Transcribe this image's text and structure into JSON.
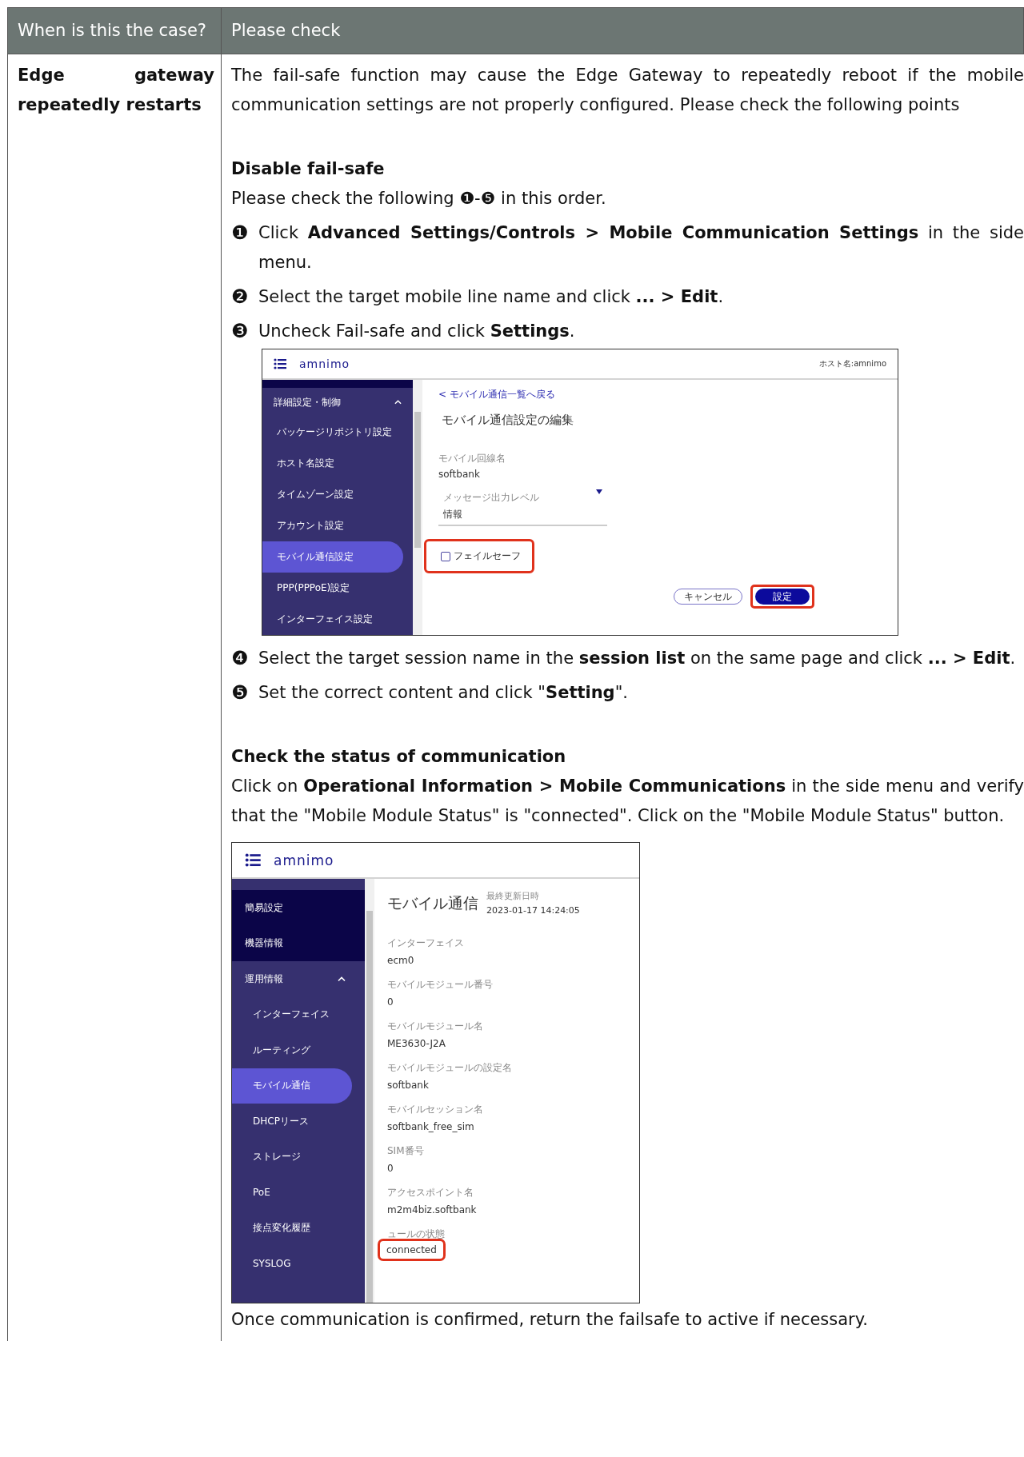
{
  "header": {
    "case_heading": "When is this the case?",
    "check_heading": "Please check"
  },
  "case": "Edge gateway repeatedly restarts",
  "blocks": [
    {
      "kind": "paragraph",
      "text": "The fail-safe function may cause the Edge Gateway to repeatedly reboot if the mobile communication settings are not properly configured. Please check the following points"
    },
    {
      "kind": "heading",
      "text": "Disable fail-safe"
    },
    {
      "kind": "paragraph",
      "text": "Please check the following ❶-❺ in this order."
    },
    {
      "kind": "step",
      "marker": "❶",
      "text": "Click **Advanced Settings/Controls > Mobile Communication Settings** in the side menu."
    },
    {
      "kind": "step",
      "marker": "❷",
      "text": "Select the target mobile line name and click **... > Edit**."
    },
    {
      "kind": "step",
      "marker": "❸",
      "text": "Uncheck Fail-safe and click **Settings**."
    },
    {
      "kind": "settings_screenshot",
      "logo": "amnimo",
      "host": "ホスト名:amnimo",
      "sidebar": {
        "items": [
          {
            "label": "詳細設定・制御",
            "expanded": true,
            "children": [
              {
                "label": "パッケージリポジトリ設定",
                "selected": false
              },
              {
                "label": "ホスト名設定",
                "selected": false
              },
              {
                "label": "タイムゾーン設定",
                "selected": false
              },
              {
                "label": "アカウント設定",
                "selected": false
              },
              {
                "label": "モバイル通信設定",
                "selected": true
              },
              {
                "label": "PPP(PPPoE)設定",
                "selected": false
              },
              {
                "label": "インターフェイス設定",
                "selected": false
              }
            ]
          }
        ]
      },
      "back_link": "< モバイル通信一覧へ戻る",
      "title": "モバイル通信設定の編集",
      "line_name": {
        "label": "モバイル回線名",
        "value": "softbank"
      },
      "message_level": {
        "label": "メッセージ出力レベル",
        "value": "情報"
      },
      "checkbox": {
        "label": "フェイルセーフ",
        "checked": false,
        "highlighted": true
      },
      "buttons": [
        {
          "label": "キャンセル",
          "kind": "outline",
          "highlighted": false
        },
        {
          "label": "設定",
          "kind": "primary",
          "highlighted": true
        }
      ]
    },
    {
      "kind": "step",
      "marker": "❹",
      "text": "Select the target session name in the **session list** on the same page and click **... > Edit**."
    },
    {
      "kind": "step",
      "marker": "❺",
      "text": "Set the correct content and click \"**Setting**\"."
    },
    {
      "kind": "heading",
      "text": "Check the status of communication"
    },
    {
      "kind": "paragraph",
      "text": "Click on **Operational Information > Mobile Communications** in the side menu and verify that the \"Mobile Module Status\" is \"connected\". Click on the \"Mobile Module Status\" button."
    },
    {
      "kind": "status_screenshot",
      "logo": "amnimo",
      "sidebar": {
        "items": [
          {
            "label": "簡易設定",
            "selected": false
          },
          {
            "label": "機器情報",
            "selected": false
          },
          {
            "label": "運用情報",
            "expanded": true,
            "children": [
              {
                "label": "インターフェイス",
                "selected": false
              },
              {
                "label": "ルーティング",
                "selected": false
              },
              {
                "label": "モバイル通信",
                "selected": true
              },
              {
                "label": "DHCPリース",
                "selected": false
              },
              {
                "label": "ストレージ",
                "selected": false
              },
              {
                "label": "PoE",
                "selected": false
              },
              {
                "label": "接点変化履歴",
                "selected": false
              },
              {
                "label": "SYSLOG",
                "selected": false
              }
            ]
          }
        ]
      },
      "title": "モバイル通信",
      "updated_label": "最終更新日時",
      "updated": "2023-01-17 14:24:05",
      "fields": [
        {
          "label": "インターフェイス",
          "value": "ecm0",
          "highlighted": false
        },
        {
          "label": "モバイルモジュール番号",
          "value": "0",
          "highlighted": false
        },
        {
          "label": "モバイルモジュール名",
          "value": "ME3630-J2A",
          "highlighted": false
        },
        {
          "label": "モバイルモジュールの設定名",
          "value": "softbank",
          "highlighted": false
        },
        {
          "label": "モバイルセッション名",
          "value": "softbank_free_sim",
          "highlighted": false
        },
        {
          "label": "SIM番号",
          "value": "0",
          "highlighted": false
        },
        {
          "label": "アクセスポイント名",
          "value": "m2m4biz.softbank",
          "highlighted": false
        },
        {
          "label": "ュールの状態",
          "value": "connected",
          "highlighted": true
        }
      ]
    },
    {
      "kind": "paragraph",
      "text": "Once communication is confirmed, return the failsafe to active if necessary."
    }
  ]
}
